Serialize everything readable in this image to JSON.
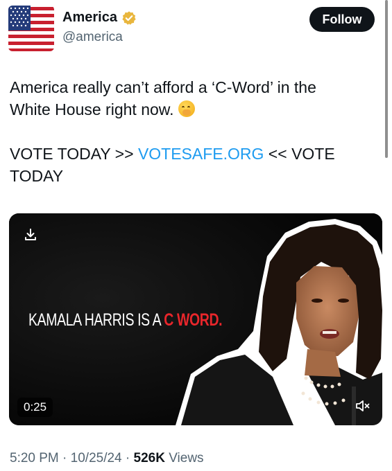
{
  "author": {
    "display_name": "America",
    "handle": "@america",
    "verified_badge_icon": "gold-verified-badge-icon",
    "avatar_icon": "us-flag-icon"
  },
  "follow_button": {
    "label": "Follow"
  },
  "tweet": {
    "line1": "America really can’t afford a ‘C-Word’ in the",
    "line2": "White House right now.",
    "emoji_icon": "face-with-hand-over-mouth-emoji",
    "line3_prefix": "VOTE TODAY >> ",
    "line3_link": "VOTESAFE.ORG",
    "line3_suffix": " << VOTE",
    "line4": "TODAY"
  },
  "video": {
    "headline_white": "KAMALA HARRIS IS A ",
    "headline_red": "C WORD.",
    "duration": "0:25",
    "download_icon": "download-icon",
    "mute_icon": "speaker-muted-icon"
  },
  "footer": {
    "time": "5:20 PM",
    "separator": " · ",
    "date": "10/25/24",
    "views_count": "526K",
    "views_label": " Views"
  },
  "colors": {
    "link": "#1d9bf0",
    "text": "#0f1419",
    "secondary": "#536471",
    "accent_red": "#e8262b",
    "badge_gold": "#e9b63d"
  }
}
